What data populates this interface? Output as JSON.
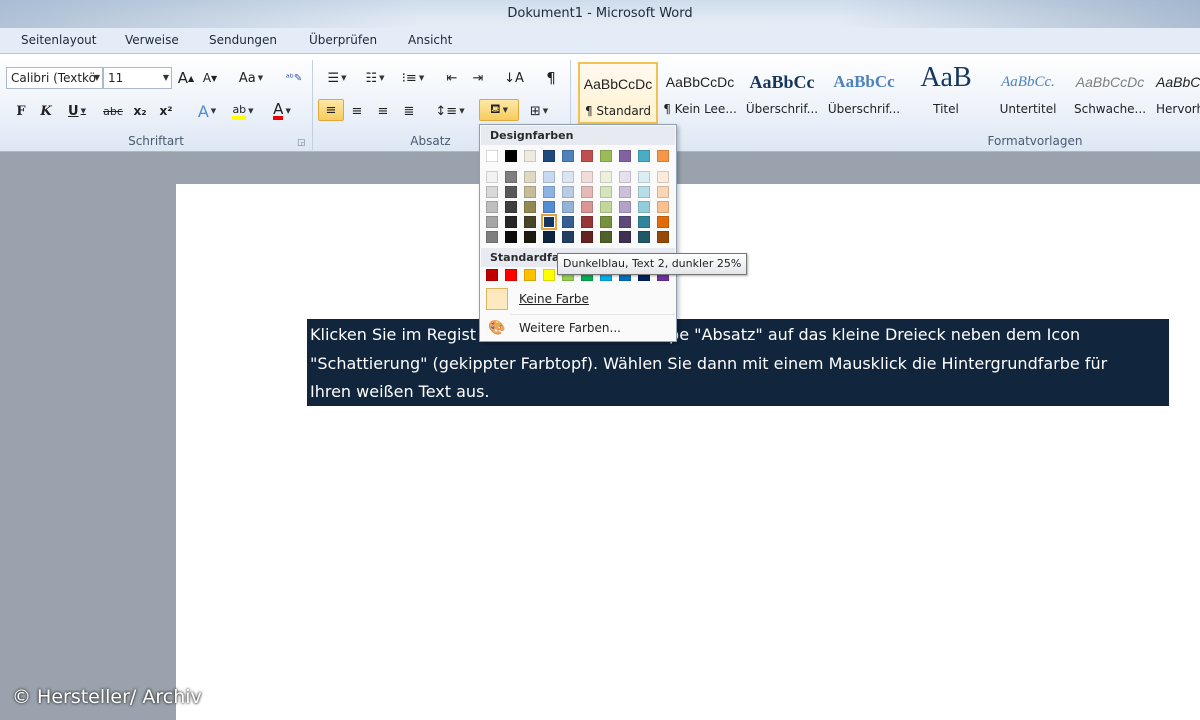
{
  "window": {
    "title": "Dokument1  -  Microsoft Word"
  },
  "tabs": [
    "Seitenlayout",
    "Verweise",
    "Sendungen",
    "Überprüfen",
    "Ansicht"
  ],
  "font_group": {
    "label": "Schriftart",
    "font_name": "Calibri (Textkö",
    "font_size": "11",
    "grow_label": "A",
    "shrink_label": "A",
    "case_label": "Aa",
    "bold": "F",
    "italic": "K",
    "underline": "U",
    "strike": "abc",
    "sub": "x₂",
    "sup": "x²",
    "highlight": "ab",
    "font_color": "A"
  },
  "paragraph_group": {
    "label": "Absatz"
  },
  "styles_group": {
    "label": "Formatvorlagen",
    "items": [
      {
        "sample": "AaBbCcDc",
        "name": "¶ Standard"
      },
      {
        "sample": "AaBbCcDc",
        "name": "¶ Kein Lee..."
      },
      {
        "sample": "AaBbCc",
        "name": "Überschrif..."
      },
      {
        "sample": "AaBbCc",
        "name": "Überschrif..."
      },
      {
        "sample": "AaB",
        "name": "Titel"
      },
      {
        "sample": "AaBbCc.",
        "name": "Untertitel"
      },
      {
        "sample": "AaBbCcDc",
        "name": "Schwache..."
      },
      {
        "sample": "AaBbC",
        "name": "Hervorh"
      }
    ]
  },
  "color_picker": {
    "theme_header": "Designfarben",
    "standard_header": "Standardfa",
    "theme_top": [
      "#ffffff",
      "#000000",
      "#eeece1",
      "#1f497d",
      "#4f81bd",
      "#c0504d",
      "#9bbb59",
      "#8064a2",
      "#4bacc6",
      "#f79646"
    ],
    "theme_shades": [
      [
        "#f2f2f2",
        "#7f7f7f",
        "#ddd9c3",
        "#c6d9f0",
        "#dbe5f1",
        "#f2dcdb",
        "#ebf1dd",
        "#e5e0ec",
        "#dbeef3",
        "#fdeada"
      ],
      [
        "#d8d8d8",
        "#595959",
        "#c4bd97",
        "#8db3e2",
        "#b8cce4",
        "#e5b9b7",
        "#d7e3bc",
        "#ccc1d9",
        "#b7dde8",
        "#fbd5b5"
      ],
      [
        "#bfbfbf",
        "#3f3f3f",
        "#938953",
        "#548dd4",
        "#95b3d7",
        "#d99694",
        "#c3d69b",
        "#b2a2c7",
        "#92cddc",
        "#fac08f"
      ],
      [
        "#a5a5a5",
        "#262626",
        "#494429",
        "#17365d",
        "#366092",
        "#953734",
        "#76923c",
        "#5f497a",
        "#31859b",
        "#e36c09"
      ],
      [
        "#7f7f7f",
        "#0c0c0c",
        "#1d1b10",
        "#0f243e",
        "#244061",
        "#632423",
        "#4f6128",
        "#3f3151",
        "#205867",
        "#974806"
      ]
    ],
    "standard_colors": [
      "#c00000",
      "#ff0000",
      "#ffc000",
      "#ffff00",
      "#92d050",
      "#00b050",
      "#00b0f0",
      "#0070c0",
      "#002060",
      "#7030a0"
    ],
    "no_color_label": "Keine Farbe",
    "more_colors_label": "Weitere Farben...",
    "tooltip": "Dunkelblau, Text 2, dunkler 25%"
  },
  "document": {
    "lines": [
      "Klicken Sie im Regist",
      "pe \"Absatz\" auf das kleine Dreieck neben dem Icon",
      "\"Schattierung\" (gekippter Farbtopf). Wählen Sie dann mit einem Mausklick die Hintergrundfarbe für",
      "Ihren weißen Text aus."
    ],
    "selection_color": "#11253d"
  },
  "watermark": "© Hersteller/ Archiv"
}
